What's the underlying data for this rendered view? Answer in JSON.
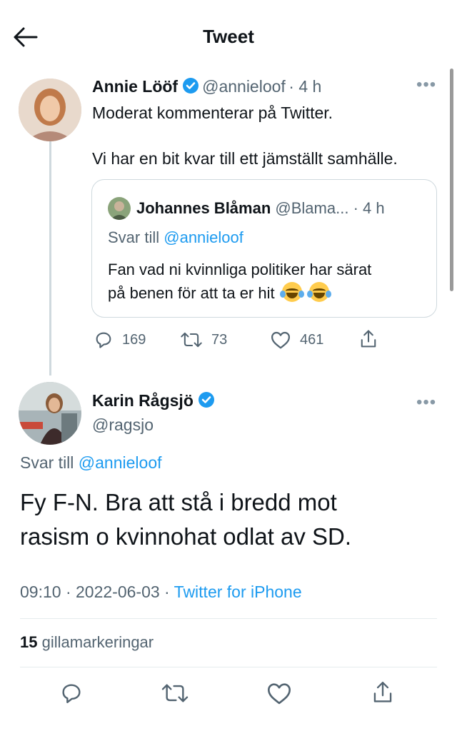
{
  "header": {
    "title": "Tweet"
  },
  "original": {
    "name": "Annie Lööf",
    "handle": "@annieloof",
    "time": "· 4 h",
    "line1": "Moderat kommenterar på Twitter.",
    "line2": "Vi har en bit kvar till ett jämställt samhälle."
  },
  "quoted": {
    "name": "Johannes Blåman",
    "handle": "@Blama...",
    "time": "· 4 h",
    "reply_prefix": "Svar till ",
    "reply_handle": "@annieloof",
    "line1": "Fan vad ni kvinnliga politiker har särat",
    "line2": "på benen för att ta er hit",
    "emoji": "face-with-tears-of-joy x2"
  },
  "stats": {
    "replies": "169",
    "retweets": "73",
    "likes": "461"
  },
  "reply": {
    "name": "Karin Rågsjö",
    "handle": "@ragsjo",
    "reply_prefix": "Svar till ",
    "reply_handle": "@annieloof",
    "line1": "Fy F-N. Bra att stå i bredd mot",
    "line2": "rasism o kvinnohat odlat av SD.",
    "timestamp": "09:10 · 2022-06-03 · ",
    "source": "Twitter for iPhone",
    "likes_count": "15",
    "likes_label": "gillamarkeringar"
  },
  "colors": {
    "link": "#1d9bf0",
    "verified": "#1d9bf0",
    "muted": "#536471"
  },
  "icons": [
    "back-arrow-icon",
    "verified-icon",
    "more-icon",
    "reply-icon",
    "retweet-icon",
    "like-icon",
    "share-icon"
  ]
}
